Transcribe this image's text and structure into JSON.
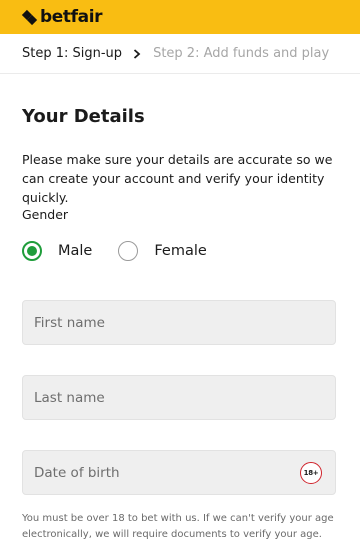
{
  "brand": {
    "name": "betfair",
    "bar_color": "#f9bd12"
  },
  "steps": {
    "current": "Step 1: Sign-up",
    "next": "Step 2: Add funds and play",
    "separator_icon": "chevron-right-icon"
  },
  "form": {
    "title": "Your Details",
    "intro": "Please make sure your details are accurate so we can create your account and verify your identity quickly.",
    "gender": {
      "label": "Gender",
      "options": [
        {
          "label": "Male",
          "selected": true
        },
        {
          "label": "Female",
          "selected": false
        }
      ],
      "accent": "#1f9d3b"
    },
    "first_name": {
      "placeholder": "First name",
      "value": ""
    },
    "last_name": {
      "placeholder": "Last name",
      "value": ""
    },
    "dob": {
      "placeholder": "Date of birth",
      "value": "",
      "badge": "18+"
    },
    "disclaimer": "You must be over 18 to bet with us. If we can't verify your age electronically, we will require documents to verify your age."
  }
}
